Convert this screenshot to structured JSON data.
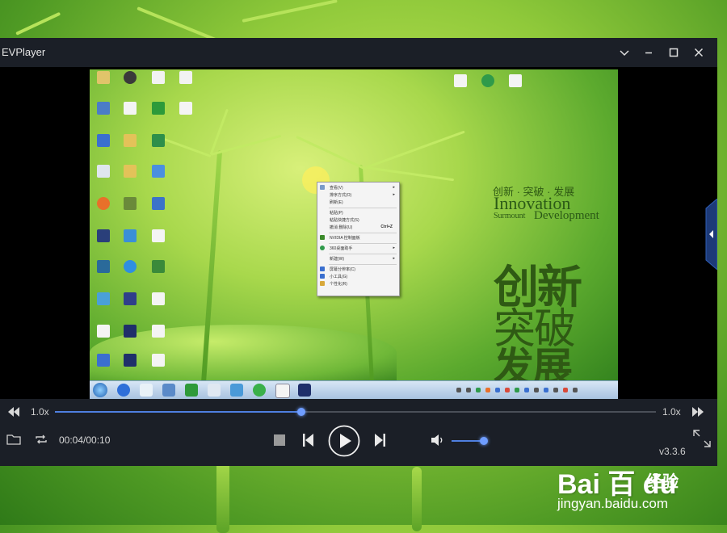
{
  "window": {
    "title": "EVPlayer",
    "titlebar_buttons": [
      "chevron-down-icon",
      "minimize-icon",
      "maximize-icon",
      "close-icon"
    ]
  },
  "video_frame": {
    "desktop_watermark": {
      "cn_line": "创新 · 突破 · 发展",
      "en_line1": "Innovation",
      "en_line2_a": "Surmount",
      "en_line2_b": "Development",
      "big_cn_1": "创新",
      "big_cn_2": "突破",
      "big_cn_3": "发展"
    },
    "context_menu_items": [
      "查看(V)",
      "排序方式(O)",
      "刷新(E)",
      "粘贴(P)",
      "粘贴快捷方式(S)",
      "撤消 删除(U)",
      "NVIDIA 控制面板",
      "360桌面助手",
      "新建(W)",
      "屏幕分辨率(C)",
      "小工具(G)",
      "个性化(R)"
    ],
    "context_menu_shortcut": "Ctrl+Z"
  },
  "controls": {
    "speed_left": "1.0x",
    "speed_right": "1.0x",
    "progress": 0.41,
    "time": "00:04/00:10",
    "volume": 0.9,
    "version": "v3.3.6",
    "accent_color": "#4f7fe0"
  },
  "watermark": {
    "logo": "Bai 百 du",
    "cn": "经验",
    "url": "jingyan.baidu.com"
  }
}
